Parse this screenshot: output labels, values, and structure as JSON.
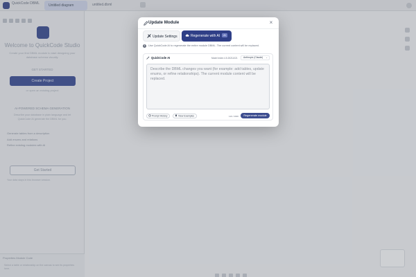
{
  "background": {
    "app_name": "QuickCode DBML",
    "active_tab": "Untitled diagram",
    "breadcrumb": "untitled.dbml",
    "welcome_title": "Welcome to QuickCode Studio",
    "welcome_subtitle": "Create your first DBML module to start designing your database schema visually.",
    "get_started": "GET STARTED",
    "create_button": "Create Project",
    "or_text": "or open an existing project",
    "section_title": "AI-POWERED SCHEMA GENERATION",
    "section_subtitle": "Describe your database in plain language and let QuickCode AI generate the DBML for you.",
    "list_items": [
      "Generate tables from a description",
      "Add enums and relations",
      "Refine existing modules with AI"
    ],
    "outline_button": "Get Started",
    "note": "Your data stays in this browser session.",
    "footer_tabs": "Properties   Module Code",
    "footer_text": "Select a table or relationship on the canvas to see its properties here."
  },
  "modal": {
    "title": "Update Module",
    "close_label": "×",
    "tabs": [
      {
        "label": "Update Settings",
        "icon": "settings-icon"
      },
      {
        "label": "Regenerate with AI",
        "icon": "ai-cloud-icon",
        "badge": "AI"
      }
    ],
    "info_text": "Use QuickCode AI to regenerate the entire module DBML. The current content will be replaced.",
    "ai_panel": {
      "brand": "QuickCode AI",
      "index_info": "Model Index 4.5.20211021",
      "model": "Anthropic (Claude)",
      "prompt_placeholder": "Describe the DBML changes you want (for example: add tables, update enums, or refine relationships). The current module content will be replaced.",
      "prompt_value": "",
      "history_label": "Prompt History",
      "examples_label": "View Examples",
      "char_count": "119 / 2000",
      "regenerate_label": "Regenerate module"
    }
  },
  "colors": {
    "accent": "#2f3f87",
    "button": "#3d4d8f",
    "overlay": "rgba(80,85,95,0.22)"
  }
}
